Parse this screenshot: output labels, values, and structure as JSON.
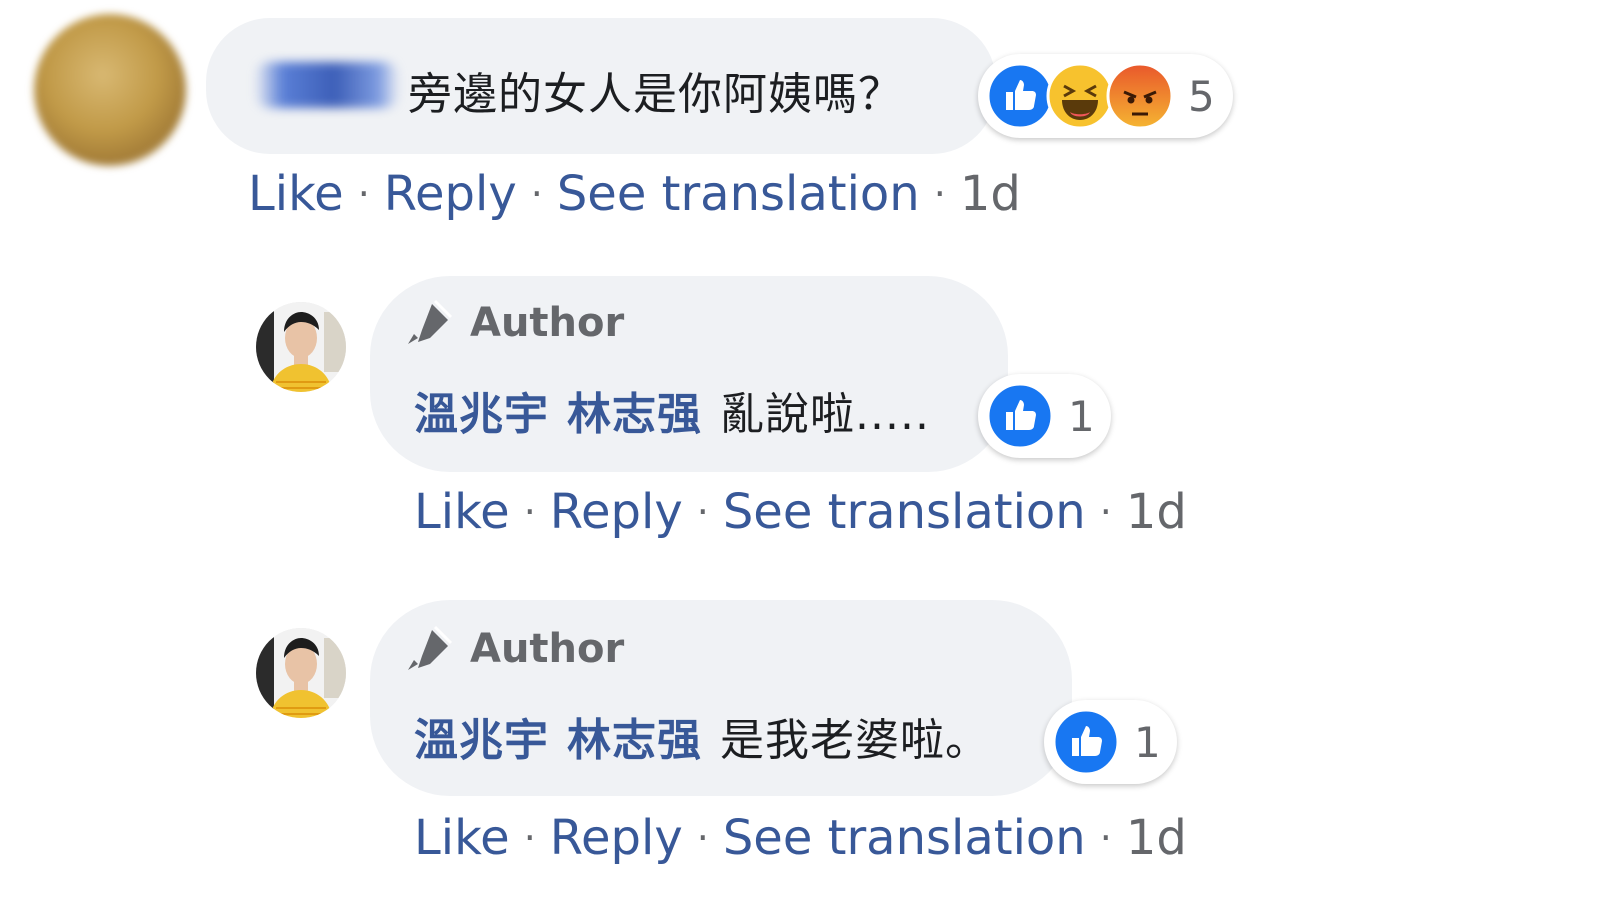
{
  "comment": {
    "text": "旁邊的女人是你阿姨嗎？",
    "reaction_count": "5",
    "reactions": [
      "like-icon",
      "haha-icon",
      "angry-icon"
    ],
    "actions": {
      "like": "Like",
      "reply": "Reply",
      "translate": "See translation",
      "time": "1d"
    }
  },
  "replies": [
    {
      "badge": "Author",
      "mention1": "溫兆宇",
      "mention2": "林志强",
      "text": "亂說啦.....",
      "reaction_count": "1",
      "actions": {
        "like": "Like",
        "reply": "Reply",
        "translate": "See translation",
        "time": "1d"
      }
    },
    {
      "badge": "Author",
      "mention1": "溫兆宇",
      "mention2": "林志强",
      "text": "是我老婆啦。",
      "reaction_count": "1",
      "actions": {
        "like": "Like",
        "reply": "Reply",
        "translate": "See translation",
        "time": "1d"
      }
    }
  ],
  "colors": {
    "bubble": "#f0f2f5",
    "link": "#385898",
    "muted": "#65676b",
    "like_blue": "#1877f2"
  }
}
